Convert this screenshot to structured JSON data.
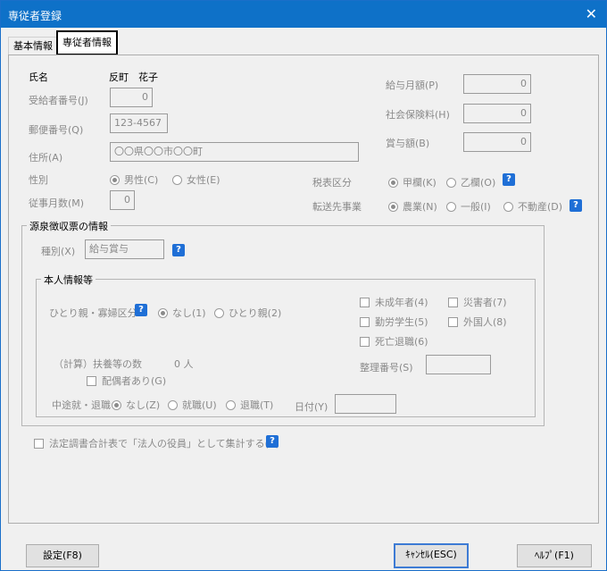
{
  "window": {
    "title": "専従者登録",
    "close_glyph": "✕"
  },
  "tabs": [
    {
      "label": "基本情報"
    },
    {
      "label": "専従者情報"
    }
  ],
  "fields": {
    "name_label": "氏名",
    "name_value": "反町　花子",
    "recipient_no_label": "受給者番号(J)",
    "recipient_no_value": "0",
    "postal_label": "郵便番号(Q)",
    "postal_value": "123-4567",
    "address_label": "住所(A)",
    "address_value": "〇〇県〇〇市〇〇町",
    "gender_label": "性別",
    "gender_male": "男性(C)",
    "gender_female": "女性(E)",
    "months_label": "従事月数(M)",
    "months_value": "0",
    "salary_label": "給与月額(P)",
    "salary_value": "0",
    "insurance_label": "社会保険料(H)",
    "insurance_value": "0",
    "bonus_label": "賞与額(B)",
    "bonus_value": "0",
    "tax_label": "税表区分",
    "tax_kou": "甲欄(K)",
    "tax_otsu": "乙欄(O)",
    "transfer_label": "転送先事業",
    "transfer_agri": "農業(N)",
    "transfer_general": "一般(I)",
    "transfer_realestate": "不動産(D)"
  },
  "withholding": {
    "title": "源泉徴収票の情報",
    "kind_label": "種別(X)",
    "kind_value": "給与賞与",
    "personal": {
      "title": "本人情報等",
      "single_parent_label": "ひとり親・寡婦区分",
      "single_none": "なし(1)",
      "single_parent": "ひとり親(2)",
      "minor": "未成年者(4)",
      "disaster": "災害者(7)",
      "working_student": "勤労学生(5)",
      "foreigner": "外国人(8)",
      "retired_death": "死亡退職(6)",
      "dependents_label": "（計算）扶養等の数",
      "dependents_value": "0 人",
      "spouse_label": "配偶者あり(G)",
      "ref_no_label": "整理番号(S)",
      "ref_no_value": "",
      "midterm_label": "中途就・退職",
      "mid_none": "なし(Z)",
      "mid_hire": "就職(U)",
      "mid_retire": "退職(T)",
      "date_label": "日付(Y)",
      "date_value": ""
    }
  },
  "legal_check_label": "法定調書合計表で「法人の役員」として集計する(R)",
  "help_glyph": "?",
  "buttons": {
    "settings": "設定(F8)",
    "cancel": "ｷｬﾝｾﾙ(ESC)",
    "help": "ﾍﾙﾌﾟ(F1)"
  }
}
